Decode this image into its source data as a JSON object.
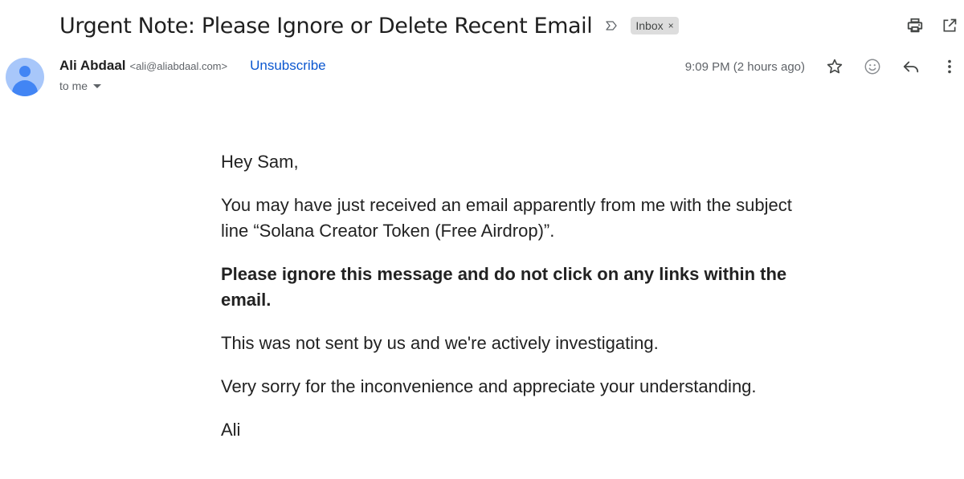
{
  "email": {
    "subject": "Urgent Note: Please Ignore or Delete Recent Email",
    "label": "Inbox",
    "label_remove": "×",
    "sender_name": "Ali Abdaal",
    "sender_email": "<ali@aliabdaal.com>",
    "unsubscribe": "Unsubscribe",
    "recipient": "to me",
    "timestamp": "9:09 PM (2 hours ago)",
    "body": {
      "greeting": "Hey Sam,",
      "para1": "You may have just received an email apparently from me with the subject line “Solana Creator Token (Free Airdrop)”.",
      "para2": "Please ignore this message and do not click on any links within the email.",
      "para3": "This was not sent by us and we're actively investigating.",
      "para4": "Very sorry for the inconvenience and appreciate your understanding.",
      "signature": "Ali"
    }
  },
  "icons": {
    "importance": "importance-marker-icon",
    "print": "print-icon",
    "open_new_window": "open-in-new-window-icon",
    "star": "star-icon",
    "emoji": "emoji-reaction-icon",
    "reply": "reply-icon",
    "more": "more-vertical-icon",
    "avatar": "default-avatar"
  },
  "colors": {
    "link": "#0b57d0",
    "avatar_bg": "#a8c7fa",
    "avatar_fg": "#4285f4",
    "chip_bg": "#dddddd",
    "muted_text": "#5f6368"
  }
}
